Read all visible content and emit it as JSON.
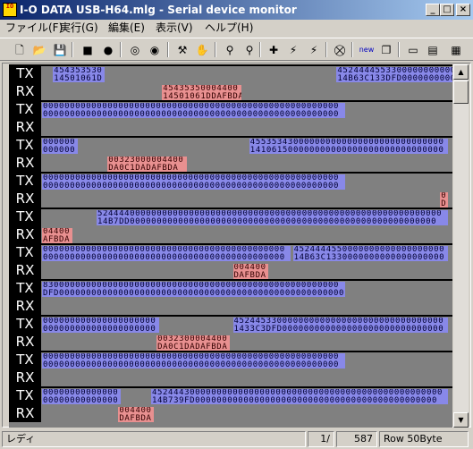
{
  "window": {
    "title": "I-O DATA USB-H64.mlg - Serial device monitor",
    "icon_text": "IO",
    "controls": {
      "minimize": "_",
      "maximize": "□",
      "close": "×"
    }
  },
  "menu": [
    {
      "label": "ファイル(F)"
    },
    {
      "label": "実行(G)"
    },
    {
      "label": "編集(E)"
    },
    {
      "label": "表示(V)"
    },
    {
      "label": "ヘルプ(H)"
    }
  ],
  "toolbar": [
    {
      "name": "new-file-icon",
      "glyph": "🗋"
    },
    {
      "name": "open-folder-icon",
      "glyph": "📂"
    },
    {
      "name": "save-icon",
      "glyph": "💾"
    },
    {
      "name": "stop-icon",
      "glyph": "■"
    },
    {
      "name": "record-icon",
      "glyph": "●"
    },
    {
      "name": "capture-icon",
      "glyph": "◎"
    },
    {
      "name": "monitor-eye-icon",
      "glyph": "◉"
    },
    {
      "name": "settings-tools-icon",
      "glyph": "⚒"
    },
    {
      "name": "hand-icon",
      "glyph": "✋"
    },
    {
      "name": "find-binoculars-icon",
      "glyph": "⚲"
    },
    {
      "name": "find-next-icon",
      "glyph": "⚲"
    },
    {
      "name": "add-device-icon",
      "glyph": "✚"
    },
    {
      "name": "connect-icon",
      "glyph": "⚡"
    },
    {
      "name": "disconnect-icon",
      "glyph": "⚡"
    },
    {
      "name": "export-icon",
      "glyph": "⛒"
    },
    {
      "name": "new-window-icon",
      "glyph": "new"
    },
    {
      "name": "cascade-windows-icon",
      "glyph": "❐"
    },
    {
      "name": "view-single-icon",
      "glyph": "▭"
    },
    {
      "name": "view-split-icon",
      "glyph": "▤"
    },
    {
      "name": "view-list-icon",
      "glyph": "▦"
    }
  ],
  "rows": [
    {
      "label": "TX",
      "blocks": [
        {
          "c": 2,
          "n": 9,
          "top": "454353530",
          "bot": "14501061D"
        },
        {
          "c": 54,
          "n": 54,
          "top": "452444455330000000000000000000000000000000000000000000",
          "bot": "14B63C133DFD00000000000000000000000000000000000000000"
        }
      ]
    },
    {
      "label": "RX",
      "blocks": [
        {
          "c": 22,
          "n": 14,
          "top": "45435350004400",
          "bot": "14501061DDAFBDA"
        }
      ]
    },
    {
      "label": "TX",
      "blocks": [
        {
          "c": 0,
          "n": 55,
          "top": "0000000000000000000000000000000000000000000000000000000",
          "bot": "0000000000000000000000000000000000000000000000000000000"
        }
      ]
    },
    {
      "label": "RX",
      "blocks": []
    },
    {
      "label": "TX",
      "blocks": [
        {
          "c": 0,
          "n": 6,
          "top": "000000",
          "bot": "000000"
        },
        {
          "c": 38,
          "n": 36,
          "top": "455353430000000000000000000000000000",
          "bot": "141061500000000000000000000000000000"
        }
      ]
    },
    {
      "label": "RX",
      "blocks": [
        {
          "c": 12,
          "n": 14,
          "top": "00323000004400",
          "bot": "DA0C1DADAFBDA"
        }
      ]
    },
    {
      "label": "TX",
      "blocks": [
        {
          "c": 0,
          "n": 55,
          "top": "0000000000000000000000000000000000000000000000000000000",
          "bot": "0000000000000000000000000000000000000000000000000000000"
        }
      ]
    },
    {
      "label": "RX",
      "blocks": [
        {
          "c": 73,
          "n": 1,
          "top": "0",
          "bot": "D"
        }
      ]
    },
    {
      "label": "TX",
      "blocks": [
        {
          "c": 10,
          "n": 64,
          "top": "5244440000000000000000000000000000000000000000000000000000000000",
          "bot": "14B7DD000000000000000000000000000000000000000000000000000000000"
        }
      ]
    },
    {
      "label": "RX",
      "blocks": [
        {
          "c": 0,
          "n": 5,
          "top": "04400",
          "bot": "AFBDA"
        }
      ]
    },
    {
      "label": "TX",
      "blocks": [
        {
          "c": 0,
          "n": 45,
          "top": "000000000000000000000000000000000000000000000",
          "bot": "000000000000000000000000000000000000000000000"
        },
        {
          "c": 46,
          "n": 28,
          "top": "4524444550000000000000000000",
          "bot": "14B63C1330000000000000000000"
        }
      ]
    },
    {
      "label": "RX",
      "blocks": [
        {
          "c": 35,
          "n": 6,
          "top": "004400",
          "bot": "DAFBDA"
        }
      ]
    },
    {
      "label": "TX",
      "blocks": [
        {
          "c": 0,
          "n": 55,
          "top": "8300000000000000000000000000000000000000000000000000000",
          "bot": "DFD00000000000000000000000000000000000000000000000000000"
        }
      ]
    },
    {
      "label": "RX",
      "blocks": []
    },
    {
      "label": "TX",
      "blocks": [
        {
          "c": 0,
          "n": 21,
          "top": "000000000000000000000",
          "bot": "000000000000000000000"
        },
        {
          "c": 35,
          "n": 39,
          "top": "452445330000000000000000000000000000000",
          "bot": "1433C3DFD000000000000000000000000000000"
        }
      ]
    },
    {
      "label": "RX",
      "blocks": [
        {
          "c": 21,
          "n": 13,
          "top": "0032300004400",
          "bot": "DA0C1DADAFBDA"
        }
      ]
    },
    {
      "label": "TX",
      "blocks": [
        {
          "c": 0,
          "n": 55,
          "top": "0000000000000000000000000000000000000000000000000000000",
          "bot": "0000000000000000000000000000000000000000000000000000000"
        }
      ]
    },
    {
      "label": "RX",
      "blocks": []
    },
    {
      "label": "TX",
      "blocks": [
        {
          "c": 0,
          "n": 14,
          "top": "00000000000000",
          "bot": "00000000000000"
        },
        {
          "c": 20,
          "n": 54,
          "top": "452444300000000000000000000000000000000000000000000000",
          "bot": "14B739FD000000000000000000000000000000000000000000000"
        }
      ]
    },
    {
      "label": "RX",
      "blocks": [
        {
          "c": 14,
          "n": 6,
          "top": "004400",
          "bot": "DAFBDA"
        }
      ]
    }
  ],
  "scrollbar": {
    "up": "▲",
    "down": "▼"
  },
  "status": {
    "ready": "レディ",
    "position": "1/",
    "total": "587",
    "mode": "Row 50Byte"
  }
}
